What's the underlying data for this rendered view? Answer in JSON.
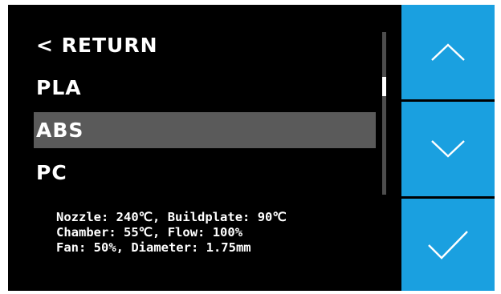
{
  "menu": {
    "items": [
      {
        "label": "< RETURN",
        "selected": false
      },
      {
        "label": "PLA",
        "selected": false
      },
      {
        "label": "ABS",
        "selected": true
      },
      {
        "label": "PC",
        "selected": false
      }
    ]
  },
  "info": {
    "line1": "Nozzle: 240℃, Buildplate: 90℃",
    "line2": "Chamber: 55℃, Flow: 100%",
    "line3": "Fan: 50%, Diameter: 1.75mm"
  },
  "buttons": {
    "up_icon": "chevron-up-icon",
    "down_icon": "chevron-down-icon",
    "confirm_icon": "checkmark-icon"
  },
  "colors": {
    "screen_background": "#000000",
    "button_accent": "#1aa0e0",
    "selected_row": "#5a5a5a",
    "text": "#ffffff"
  }
}
